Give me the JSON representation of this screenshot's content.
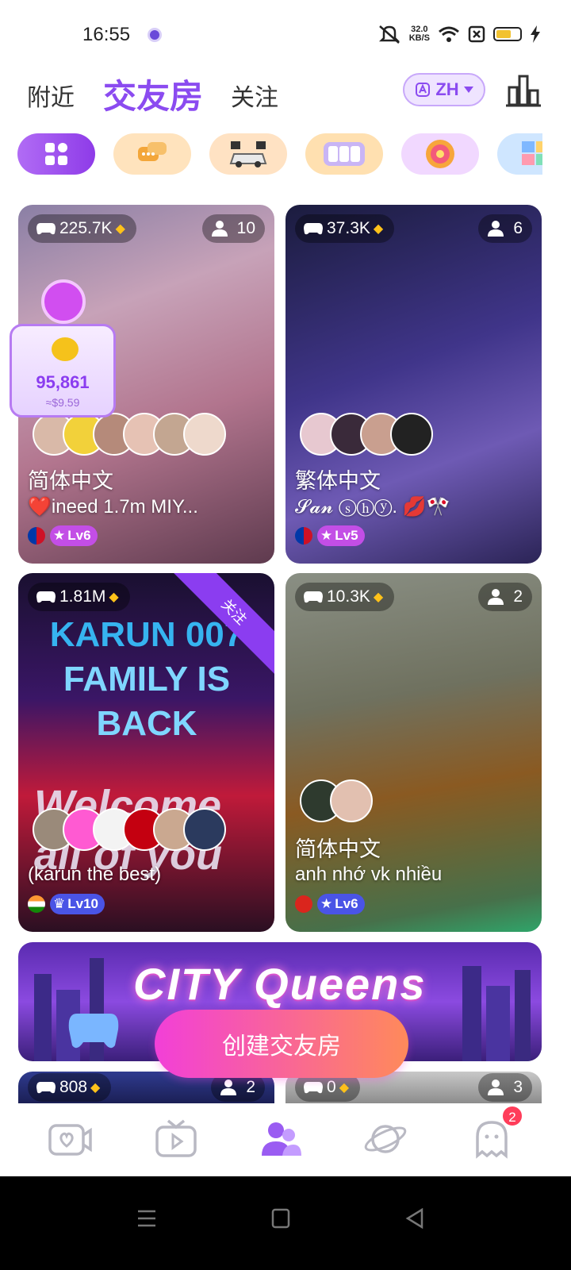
{
  "status": {
    "time": "16:55",
    "net_speed": "32.0",
    "net_unit": "KB/S"
  },
  "topnav": {
    "tabs": [
      "附近",
      "交友房",
      "关注"
    ],
    "lang": "ZH"
  },
  "categories": [
    "all",
    "chat",
    "racing",
    "number-game",
    "wheel",
    "board"
  ],
  "rooms": [
    {
      "heat": "225.7K",
      "users": "10",
      "lang": "简体中文",
      "title": "❤️ineed 1.7m  MIY...",
      "level": "Lv6",
      "flag": "Philippines"
    },
    {
      "heat": "37.3K",
      "users": "6",
      "lang": "繁体中文",
      "title": "𝓢𝓪𝓷 ⓢⓗⓨ. 💋🎌",
      "level": "Lv5",
      "flag": "Philippines"
    },
    {
      "heat": "1.81M",
      "ribbon": "关注",
      "poster_line1": "KARUN 007",
      "poster_line2": "FAMILY IS BACK",
      "poster_line3": "Welcome all of you",
      "title": "(karun the best)",
      "level": "Lv10",
      "flag": "India"
    },
    {
      "heat": "10.3K",
      "users": "2",
      "lang": "简体中文",
      "title": "anh nhớ vk nhiều",
      "level": "Lv6",
      "flag": "Vietnam"
    },
    {
      "heat": "808",
      "users": "2"
    },
    {
      "heat": "0",
      "users": "3"
    }
  ],
  "coin_widget": {
    "value": "95,861",
    "usd": "≈$9.59"
  },
  "banner": {
    "title": "CITY Queens"
  },
  "create_button": "创建交友房",
  "tabbar": {
    "badge": "2"
  },
  "colors": {
    "accent": "#8b4bf0",
    "create_start": "#f23fd8",
    "create_end": "#ff8a5a"
  }
}
